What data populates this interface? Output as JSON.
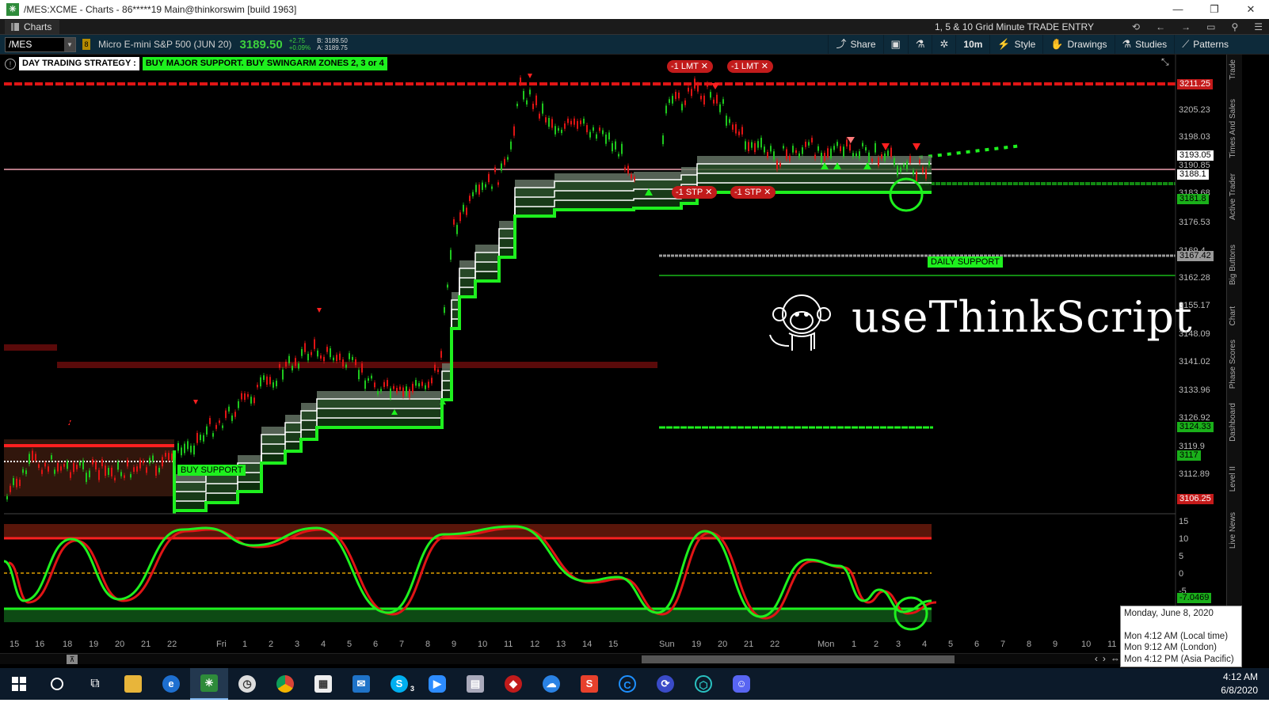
{
  "window": {
    "title": "/MES:XCME - Charts - 86*****19 Main@thinkorswim [build 1963]",
    "controls": [
      "—",
      "❐",
      "✕"
    ]
  },
  "tabs": {
    "charts_label": "Charts",
    "grid_title": "1, 5 & 10 Grid Minute TRADE ENTRY"
  },
  "toolbar": {
    "symbol": "/MES",
    "lock_label": "8",
    "description": "Micro E-mini S&P 500 (JUN 20)",
    "last_price": "3189.50",
    "change": "+2.75",
    "change_pct": "+0.09%",
    "bid": "B: 3189.50",
    "ask": "A: 3189.75",
    "share_label": "Share",
    "timeframe_label": "10m",
    "style_label": "Style",
    "drawings_label": "Drawings",
    "studies_label": "Studies",
    "patterns_label": "Patterns"
  },
  "strategy": {
    "label": "DAY TRADING STRATEGY :",
    "value": "BUY MAJOR SUPPORT. BUY SWINGARM ZONES 2, 3 or 4"
  },
  "orders": [
    "-1 LMT",
    "-1 LMT",
    "-1 STP",
    "-1 STP"
  ],
  "chart_labels": {
    "buy_support": "BUY SUPPORT",
    "daily_support": "DAILY SUPPORT",
    "brand": "useThinkScript"
  },
  "price_axis": {
    "labels": [
      "3205.23",
      "3198.03",
      "3190.85",
      "3183.68",
      "3176.53",
      "3169.4",
      "3162.28",
      "3155.17",
      "3148.09",
      "3141.02",
      "3133.96",
      "3126.92",
      "3119.9",
      "3112.89"
    ],
    "tags": {
      "red_top": "3211.25",
      "white_1": "3193.05",
      "white_2": "3188.1",
      "green_1": "3181.8",
      "gray": "3167.42",
      "green_2": "3124.33",
      "green_3": "3117",
      "red_bottom": "3106.25"
    }
  },
  "oscillator_axis": {
    "labels": [
      "15",
      "10",
      "5",
      "0",
      "-5"
    ],
    "value_tag": "-7.0469"
  },
  "time_axis": [
    "15",
    "16",
    "18",
    "19",
    "20",
    "21",
    "22",
    "Fri",
    "1",
    "2",
    "3",
    "4",
    "5",
    "6",
    "7",
    "8",
    "9",
    "10",
    "11",
    "12",
    "13",
    "14",
    "15",
    "Sun",
    "19",
    "20",
    "21",
    "22",
    "Mon",
    "1",
    "2",
    "3",
    "4",
    "5",
    "6",
    "7",
    "8",
    "9",
    "10",
    "11"
  ],
  "right_rail": [
    "Trade",
    "Times And Sales",
    "Active Trader",
    "Big Buttons",
    "Chart",
    "Phase Scores",
    "Dashboard",
    "Level II",
    "Live News"
  ],
  "tooltip": {
    "date": "Monday, June 8, 2020",
    "local": "Mon 4:12 AM  (Local time)",
    "london": "Mon 9:12 AM  (London)",
    "asia": "Mon 4:12 PM  (Asia Pacific)"
  },
  "taskbar": {
    "items": [
      "start",
      "search",
      "task-view",
      "file-explorer",
      "edge",
      "thinkorswim",
      "outlook-clock",
      "chrome",
      "calculator",
      "mail",
      "skype",
      "zoom",
      "screen-tool",
      "app-red",
      "onedrive",
      "app-s",
      "app-c",
      "app-blue",
      "app-teal",
      "discord"
    ],
    "skype_badge": "3",
    "time": "4:12 AM",
    "date": "6/8/2020"
  },
  "colors": {
    "bull": "#1ef01e",
    "bear": "#e01515",
    "background": "#000000",
    "toolbar_bg": "#0d2a3a"
  }
}
